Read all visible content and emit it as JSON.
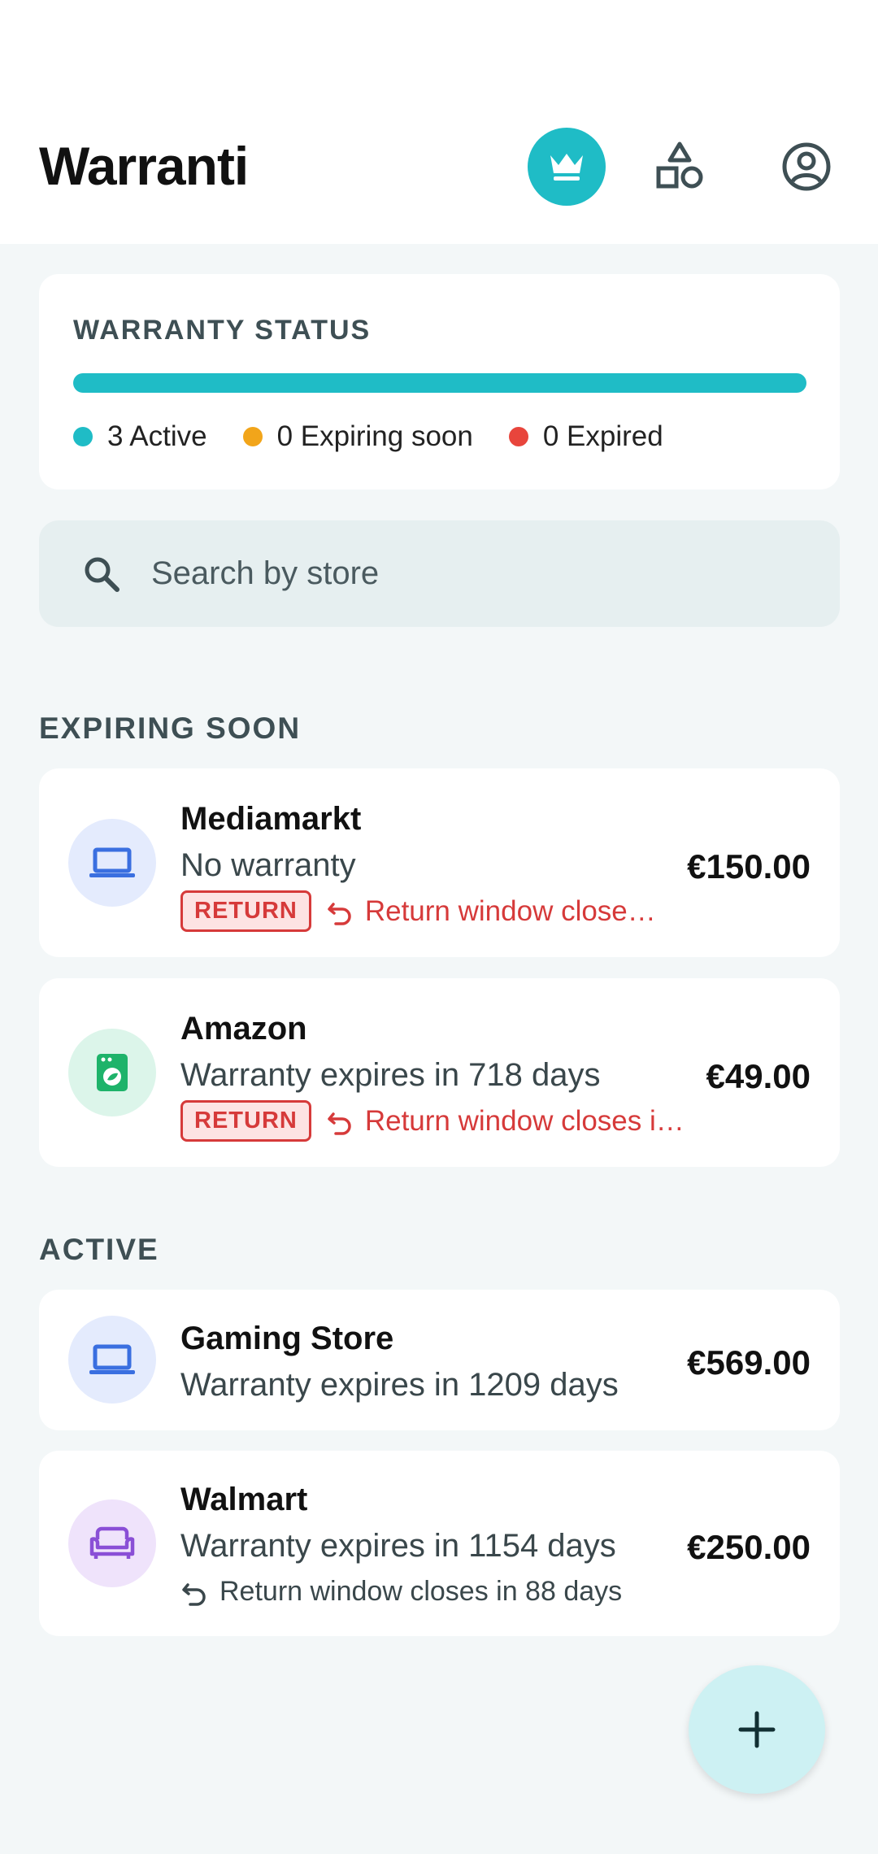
{
  "header": {
    "title": "Warranti",
    "icons": [
      "crown-icon",
      "shapes-icon",
      "account-icon"
    ]
  },
  "status": {
    "label": "WARRANTY STATUS",
    "active_fraction": 1.0,
    "legend": [
      {
        "label": "3 Active",
        "color": "#1fbcc6"
      },
      {
        "label": "0 Expiring soon",
        "color": "#f2a51a"
      },
      {
        "label": "0 Expired",
        "color": "#e8453c"
      }
    ]
  },
  "search": {
    "placeholder": "Search by store"
  },
  "sections": {
    "expiring": "EXPIRING SOON",
    "active": "ACTIVE"
  },
  "expiring_items": [
    {
      "store": "Mediamarkt",
      "subtitle": "No warranty",
      "price": "€150.00",
      "badge": "RETURN",
      "return_text": "Return window close…",
      "icon": "laptop-icon"
    },
    {
      "store": "Amazon",
      "subtitle": "Warranty expires in 718 days",
      "price": "€49.00",
      "badge": "RETURN",
      "return_text": "Return window closes i…",
      "icon": "washing-machine-icon"
    }
  ],
  "active_items": [
    {
      "store": "Gaming Store",
      "subtitle": "Warranty expires in 1209 days",
      "price": "€569.00",
      "icon": "laptop-icon"
    },
    {
      "store": "Walmart",
      "subtitle": "Warranty expires in 1154 days",
      "price": "€250.00",
      "return_text": "Return window closes in 88 days",
      "icon": "sofa-icon"
    }
  ],
  "colors": {
    "accent": "#1fbcc6",
    "warning": "#f2a51a",
    "danger": "#e8453c",
    "background": "#f3f7f8"
  }
}
